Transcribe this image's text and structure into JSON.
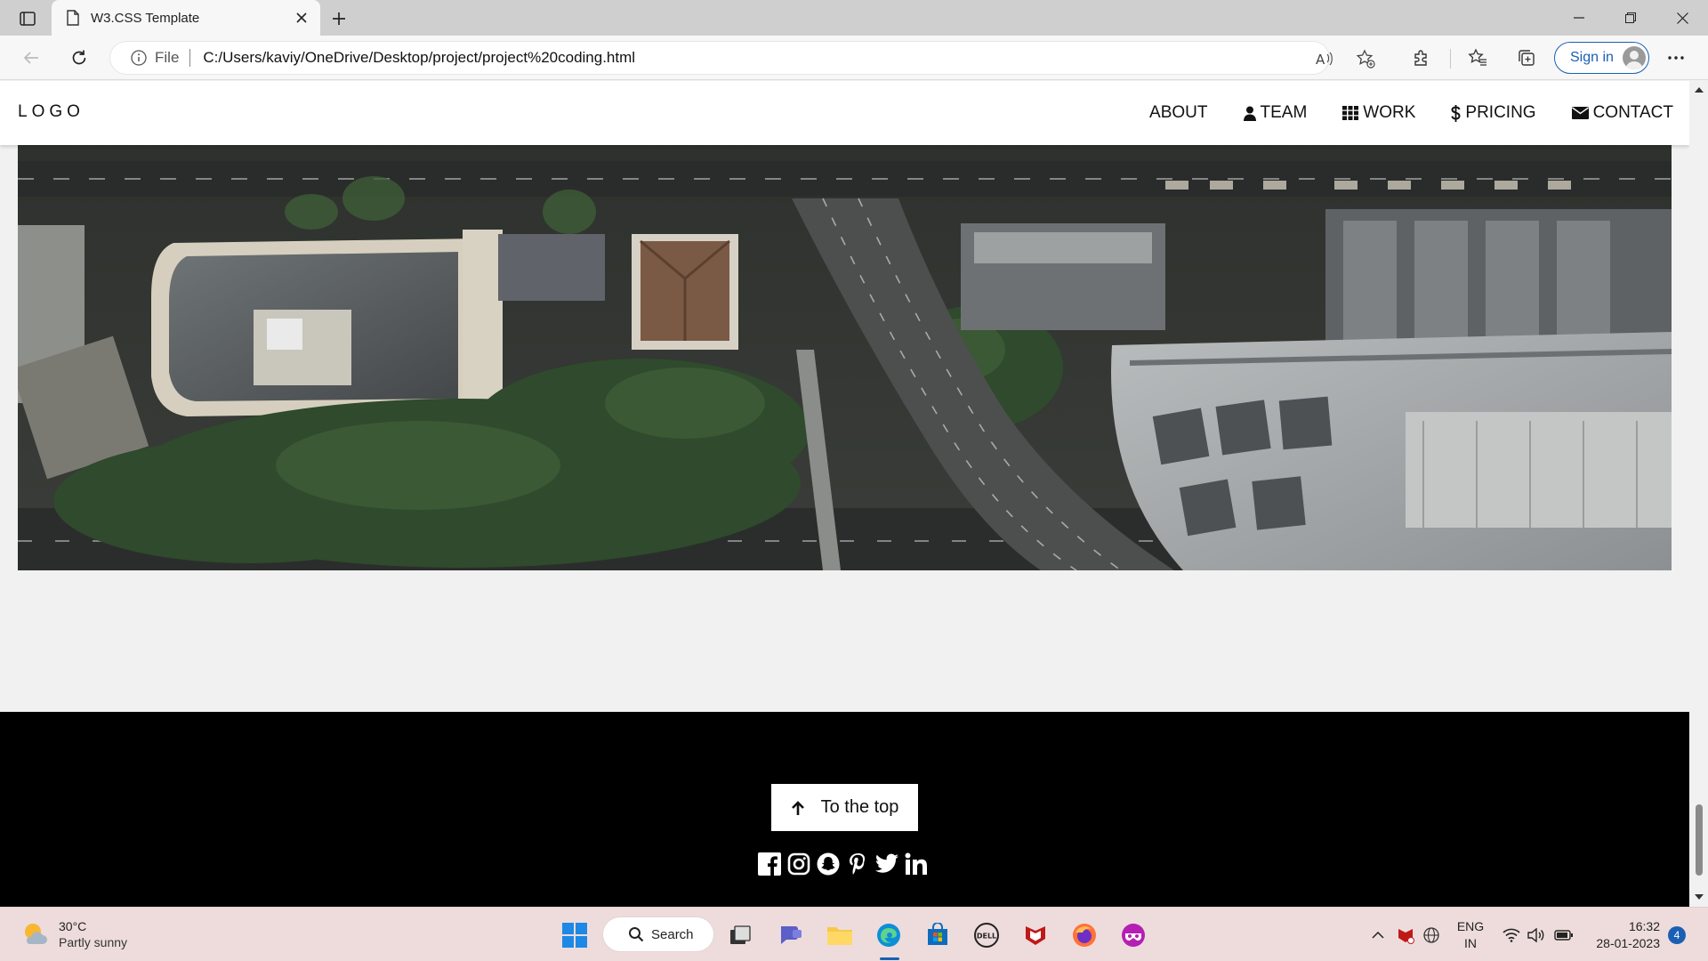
{
  "browser": {
    "tab_title": "W3.CSS Template",
    "address_scheme": "File",
    "address_url": "C:/Users/kaviy/OneDrive/Desktop/project/project%20coding.html",
    "signin_label": "Sign in"
  },
  "site": {
    "logo": "LOGO",
    "nav": [
      {
        "label": "ABOUT",
        "icon": "none"
      },
      {
        "label": "TEAM",
        "icon": "user-icon"
      },
      {
        "label": "WORK",
        "icon": "grid-icon"
      },
      {
        "label": "PRICING",
        "icon": "dollar-icon"
      },
      {
        "label": "CONTACT",
        "icon": "envelope-icon"
      }
    ],
    "hero_image": "aerial city street view",
    "footer": {
      "to_top_label": "To the top",
      "socials": [
        "facebook-icon",
        "instagram-icon",
        "snapchat-icon",
        "pinterest-icon",
        "twitter-icon",
        "linkedin-icon"
      ]
    }
  },
  "taskbar": {
    "weather_temp": "30°C",
    "weather_desc": "Partly sunny",
    "search_label": "Search",
    "lang_line1": "ENG",
    "lang_line2": "IN",
    "time": "16:32",
    "date": "28-01-2023",
    "notification_count": "4"
  },
  "colors": {
    "accent": "#1a5fb4",
    "page_bg": "#f1f1f1",
    "footer_bg": "#000000",
    "taskbar_bg": "#eedcdc"
  }
}
